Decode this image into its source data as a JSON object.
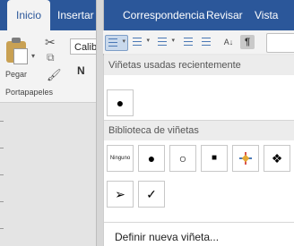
{
  "ribbon": {
    "tabs": [
      {
        "label": "Inicio",
        "active": true
      },
      {
        "label": "Insertar",
        "active": false
      },
      {
        "label": "Correspondencia",
        "active": false
      },
      {
        "label": "Revisar",
        "active": false
      },
      {
        "label": "Vista",
        "active": false
      }
    ],
    "font_name_value": "Calib",
    "bold_label": "N",
    "paste_label": "Pegar",
    "clipboard_group_label": "Portapapeles",
    "paragraph_tools": [
      "bullets-icon",
      "numbering-icon",
      "multilevel-list-icon",
      "decrease-indent-icon",
      "increase-indent-icon",
      "sort-icon",
      "show-marks-icon"
    ],
    "show_marks_glyph": "¶",
    "sort_glyph": "A↓",
    "accent": "#2b579a"
  },
  "bullets_menu": {
    "recent_title": "Viñetas usadas recientemente",
    "recent": [
      "●"
    ],
    "library_title": "Biblioteca de viñetas",
    "library": [
      {
        "label": "Ninguno",
        "icon": "none"
      },
      {
        "label": "●",
        "icon": "filled-circle-icon"
      },
      {
        "label": "○",
        "icon": "hollow-circle-icon"
      },
      {
        "label": "■",
        "icon": "filled-square-icon"
      },
      {
        "label": "",
        "icon": "four-color-star-icon"
      },
      {
        "label": "❖",
        "icon": "diamond-cluster-icon"
      },
      {
        "label": "➢",
        "icon": "arrowhead-icon"
      },
      {
        "label": "✓",
        "icon": "checkmark-icon"
      }
    ],
    "define_label": "Definir nueva viñeta..."
  }
}
